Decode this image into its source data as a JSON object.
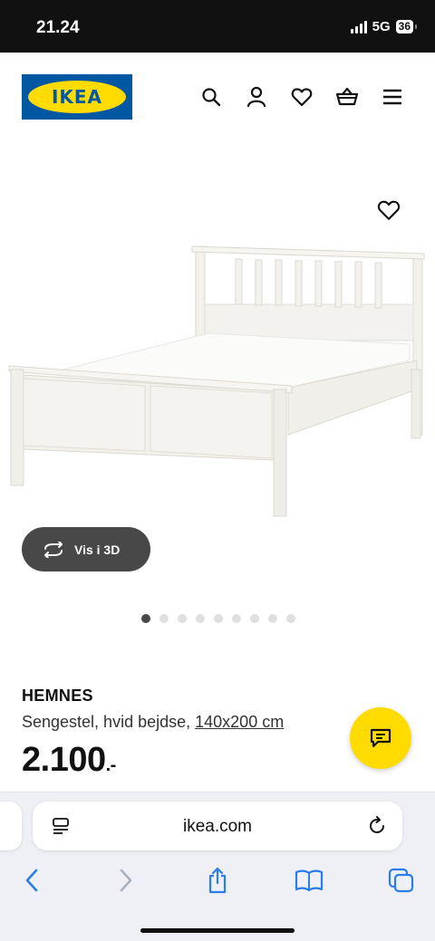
{
  "status_bar": {
    "time": "21.24",
    "network": "5G",
    "battery": "36"
  },
  "header": {
    "logo_text": "IKEA",
    "icons": [
      "search-icon",
      "profile-icon",
      "heart-icon",
      "basket-icon",
      "menu-icon"
    ]
  },
  "gallery": {
    "view_3d_label": "Vis i 3D",
    "image_count": 9,
    "active_index": 0
  },
  "product": {
    "name": "HEMNES",
    "description": "Sengestel, hvid bejdse, ",
    "size_link": "140x200 cm",
    "price": "2.100",
    "price_suffix": ".-"
  },
  "browser": {
    "url": "ikea.com"
  },
  "colors": {
    "brand_blue": "#0058a3",
    "brand_yellow": "#ffdb00",
    "dark_button": "#484848"
  }
}
